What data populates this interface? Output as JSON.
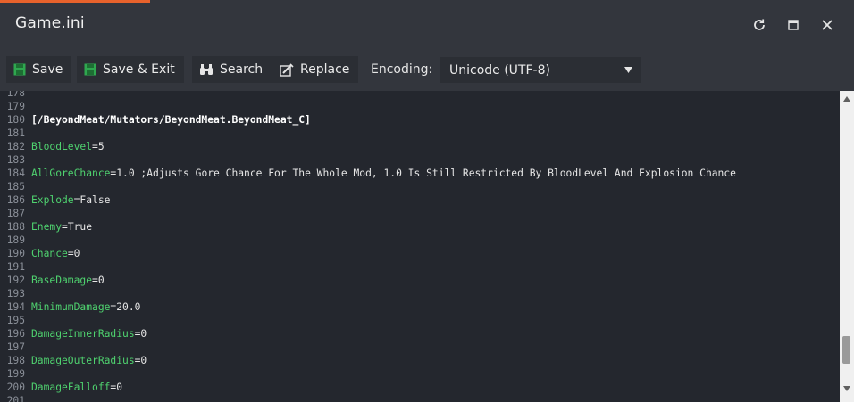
{
  "window": {
    "title": "Game.ini"
  },
  "toolbar": {
    "save_label": "Save",
    "save_exit_label": "Save & Exit",
    "search_label": "Search",
    "replace_label": "Replace",
    "encoding_label": "Encoding:",
    "encoding_value": "Unicode (UTF-8)"
  },
  "colors": {
    "accent": "#e8622c",
    "key": "#4fd26f",
    "save_icon": "#2fa84f"
  },
  "editor": {
    "lines": [
      {
        "n": "178",
        "key": "",
        "rest": ""
      },
      {
        "n": "179",
        "key": "",
        "rest": ""
      },
      {
        "n": "180",
        "section": "[/BeyondMeat/Mutators/BeyondMeat.BeyondMeat_C]"
      },
      {
        "n": "181",
        "key": "",
        "rest": ""
      },
      {
        "n": "182",
        "key": "BloodLevel",
        "rest": "=5"
      },
      {
        "n": "183",
        "key": "",
        "rest": ""
      },
      {
        "n": "184",
        "key": "AllGoreChance",
        "rest": "=1.0 ;Adjusts Gore Chance For The Whole Mod, 1.0 Is Still Restricted By BloodLevel And Explosion Chance"
      },
      {
        "n": "185",
        "key": "",
        "rest": ""
      },
      {
        "n": "186",
        "key": "Explode",
        "rest": "=False"
      },
      {
        "n": "187",
        "key": "",
        "rest": ""
      },
      {
        "n": "188",
        "key": "Enemy",
        "rest": "=True"
      },
      {
        "n": "189",
        "key": "",
        "rest": ""
      },
      {
        "n": "190",
        "key": "Chance",
        "rest": "=0"
      },
      {
        "n": "191",
        "key": "",
        "rest": ""
      },
      {
        "n": "192",
        "key": "BaseDamage",
        "rest": "=0"
      },
      {
        "n": "193",
        "key": "",
        "rest": ""
      },
      {
        "n": "194",
        "key": "MinimumDamage",
        "rest": "=20.0"
      },
      {
        "n": "195",
        "key": "",
        "rest": ""
      },
      {
        "n": "196",
        "key": "DamageInnerRadius",
        "rest": "=0"
      },
      {
        "n": "197",
        "key": "",
        "rest": ""
      },
      {
        "n": "198",
        "key": "DamageOuterRadius",
        "rest": "=0"
      },
      {
        "n": "199",
        "key": "",
        "rest": ""
      },
      {
        "n": "200",
        "key": "DamageFalloff",
        "rest": "=0"
      },
      {
        "n": "201",
        "key": "",
        "rest": ""
      }
    ]
  }
}
